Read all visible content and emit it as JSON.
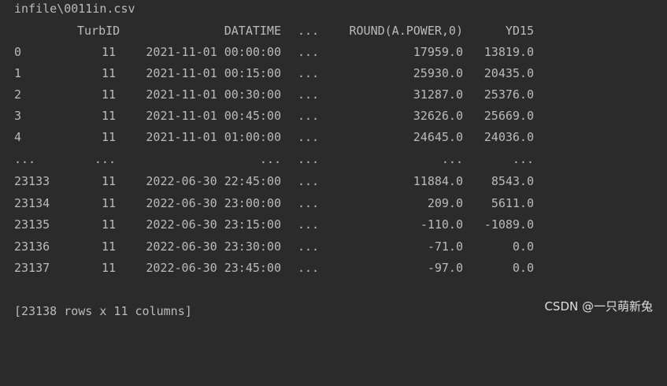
{
  "console": {
    "path": "infile\\0011in.csv",
    "columns": {
      "turbid": "TurbID",
      "datatime": "DATATIME",
      "ellipsis": "...",
      "power": "ROUND(A.POWER,0)",
      "yd15": "YD15"
    },
    "rows": [
      {
        "index": "0",
        "turbid": "11",
        "datatime": "2021-11-01 00:00:00",
        "ellipsis": "...",
        "power": "17959.0",
        "yd15": "13819.0"
      },
      {
        "index": "1",
        "turbid": "11",
        "datatime": "2021-11-01 00:15:00",
        "ellipsis": "...",
        "power": "25930.0",
        "yd15": "20435.0"
      },
      {
        "index": "2",
        "turbid": "11",
        "datatime": "2021-11-01 00:30:00",
        "ellipsis": "...",
        "power": "31287.0",
        "yd15": "25376.0"
      },
      {
        "index": "3",
        "turbid": "11",
        "datatime": "2021-11-01 00:45:00",
        "ellipsis": "...",
        "power": "32626.0",
        "yd15": "25669.0"
      },
      {
        "index": "4",
        "turbid": "11",
        "datatime": "2021-11-01 01:00:00",
        "ellipsis": "...",
        "power": "24645.0",
        "yd15": "24036.0"
      },
      {
        "index": "...",
        "turbid": "...",
        "datatime": "...",
        "ellipsis": "...",
        "power": "...",
        "yd15": "..."
      },
      {
        "index": "23133",
        "turbid": "11",
        "datatime": "2022-06-30 22:45:00",
        "ellipsis": "...",
        "power": "11884.0",
        "yd15": "8543.0"
      },
      {
        "index": "23134",
        "turbid": "11",
        "datatime": "2022-06-30 23:00:00",
        "ellipsis": "...",
        "power": "209.0",
        "yd15": "5611.0"
      },
      {
        "index": "23135",
        "turbid": "11",
        "datatime": "2022-06-30 23:15:00",
        "ellipsis": "...",
        "power": "-110.0",
        "yd15": "-1089.0"
      },
      {
        "index": "23136",
        "turbid": "11",
        "datatime": "2022-06-30 23:30:00",
        "ellipsis": "...",
        "power": "-71.0",
        "yd15": "0.0"
      },
      {
        "index": "23137",
        "turbid": "11",
        "datatime": "2022-06-30 23:45:00",
        "ellipsis": "...",
        "power": "-97.0",
        "yd15": "0.0"
      }
    ],
    "summary": "[23138 rows x 11 columns]"
  },
  "watermark": {
    "text": "CSDN @一只萌新兔"
  }
}
